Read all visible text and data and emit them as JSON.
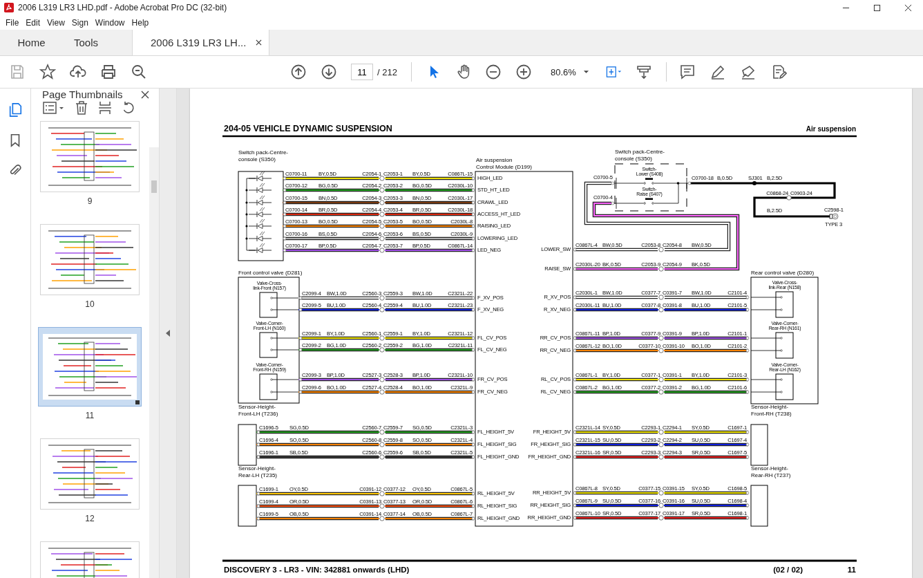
{
  "window": {
    "title": "2006 L319 LR3 LHD.pdf - Adobe Acrobat Pro DC (32-bit)"
  },
  "menu": [
    "File",
    "Edit",
    "View",
    "Sign",
    "Window",
    "Help"
  ],
  "tabs": [
    {
      "label": "Home",
      "selected": false,
      "closable": false
    },
    {
      "label": "Tools",
      "selected": false,
      "closable": false
    },
    {
      "label": "2006 L319 LR3 LH...",
      "selected": true,
      "closable": true
    }
  ],
  "toolbar": {
    "page": "11",
    "page_count": "/ 212",
    "zoom": "80.6%",
    "tools": [
      {
        "kind": "select",
        "selected": true
      },
      {
        "kind": "hand",
        "selected": false
      }
    ]
  },
  "rail": [
    {
      "kind": "pages",
      "selected": true
    },
    {
      "kind": "bookmarks",
      "selected": false
    },
    {
      "kind": "attachments",
      "selected": false
    }
  ],
  "panel": {
    "title": "Page Thumbnails",
    "thumbnails": [
      {
        "label": "9",
        "selected": false
      },
      {
        "label": "10",
        "selected": false
      },
      {
        "label": "11",
        "selected": true
      },
      {
        "label": "12",
        "selected": false
      },
      {
        "selected": false
      }
    ]
  },
  "diagram": {
    "title": "204-05 VEHICLE DYNAMIC SUSPENSION",
    "section": "Air suspension",
    "footer": "DISCOVERY 3 - LR3 - VIN: 342881 onwards  (LHD)",
    "sheet": "(02 / 02)",
    "page": "11",
    "module": {
      "lines": [
        "Air suspension",
        "Control Module (D199)"
      ]
    },
    "left_groups": [
      {
        "kind": "switch_pack",
        "lines": [
          "Switch pack-Centre-",
          "console (S350)"
        ],
        "wires": [
          {
            "from": "C0700-11",
            "spec": "BY,0.5D",
            "mid_a": "C2054-1",
            "mid_b": "C2053-1",
            "spec2": "BY,0.5D",
            "to": "C0867L-15",
            "pin": "HIGH_LED",
            "color": "#f2e600"
          },
          {
            "from": "C0700-12",
            "spec": "BG,0.5D",
            "mid_a": "C2054-2",
            "mid_b": "C2053-2",
            "spec2": "BG,0.5D",
            "to": "C2030L-10",
            "pin": "STD_HT_LED",
            "color": "#22a020"
          },
          {
            "from": "C0700-15",
            "spec": "BN,0.5D",
            "mid_a": "C2054-3",
            "mid_b": "C2053-3",
            "spec2": "BN,0.5D",
            "to": "C2030L-17",
            "pin": "CRAWL_LED",
            "color": "#7a3a10"
          },
          {
            "from": "C0700-14",
            "spec": "BR,0.5D",
            "mid_a": "C2054-4",
            "mid_b": "C2053-4",
            "spec2": "BR,0.5D",
            "to": "C2030L-18",
            "pin": "ACCESS_HT_LED",
            "color": "#e02a10"
          },
          {
            "from": "C0700-13",
            "spec": "BO,0.5D",
            "mid_a": "C2054-5",
            "mid_b": "C2053-5",
            "spec2": "BO,0.5D",
            "to": "C2030L-8",
            "pin": "RAISING_LED",
            "color": "#ff8400"
          },
          {
            "from": "C0700-16",
            "spec": "BS,0.5D",
            "mid_a": "C2054-6",
            "mid_b": "C2053-6",
            "spec2": "BS,0.5D",
            "to": "C2030L-9",
            "pin": "LOWERING_LED",
            "color": "#b4b4b4"
          },
          {
            "from": "C0700-17",
            "spec": "BP,0.5D",
            "mid_a": "C2054-7",
            "mid_b": "C2053-7",
            "spec2": "BP,0.5D",
            "to": "C0867L-14",
            "pin": "LED_NEG",
            "color": "#a050e8"
          }
        ]
      },
      {
        "kind": "valve_block",
        "lines": [
          "Front control valve (D281)"
        ],
        "parts": [
          {
            "lines": [
              "Valve-Cross-",
              "link-Front (N157)"
            ]
          },
          {
            "lines": [
              "Valve-Corner-",
              "Front-LH (N160)"
            ]
          },
          {
            "lines": [
              "Valve-Corner-",
              "Front-RH (N159)"
            ]
          }
        ],
        "wires": [
          {
            "from": "C2099-4",
            "spec": "BW,1.0D",
            "mid_a": "C2560-3",
            "mid_b": "C2559-3",
            "spec2": "BW,1.0D",
            "to": "C2321L-22",
            "pin": "F_XV_POS",
            "color": "#ffffff"
          },
          {
            "from": "C2099-5",
            "spec": "BU,1.0D",
            "mid_a": "C2560-4",
            "mid_b": "C2559-4",
            "spec2": "BU,1.0D",
            "to": "C2321L-23",
            "pin": "F_XV_NEG",
            "color": "#1020e0"
          },
          {
            "from": "C2099-1",
            "spec": "BY,1.0D",
            "mid_a": "C2560-1",
            "mid_b": "C2559-1",
            "spec2": "BY,1.0D",
            "to": "C2321L-12",
            "pin": "FL_CV_POS",
            "color": "#f2e600"
          },
          {
            "from": "C2099-2",
            "spec": "BG,1.0D",
            "mid_a": "C2560-2",
            "mid_b": "C2559-2",
            "spec2": "BG,1.0D",
            "to": "C2321L-11",
            "pin": "FL_CV_NEG",
            "color": "#22a020"
          },
          {
            "from": "C2099-3",
            "spec": "BP,1.0D",
            "mid_a": "C2527-3",
            "mid_b": "C2528-3",
            "spec2": "BP,1.0D",
            "to": "C2321L-10",
            "pin": "FR_CV_POS",
            "color": "#a050e8"
          },
          {
            "from": "C2099-6",
            "spec": "BO,1.0D",
            "mid_a": "C2527-4",
            "mid_b": "C2528-4",
            "spec2": "BO,1.0D",
            "to": "C2321L-9",
            "pin": "FR_CV_NEG",
            "color": "#ff8400"
          }
        ]
      },
      {
        "kind": "sensor",
        "lines": [
          "Sensor-Height-",
          "Front-LH (T236)"
        ],
        "wires": [
          {
            "from": "C1696-5",
            "spec": "SG,0.5D",
            "mid_a": "C2560-7",
            "mid_b": "C2559-7",
            "spec2": "SG,0.5D",
            "to": "C2321L-3",
            "pin": "FL_HEIGHT_5V",
            "color": "#22a020"
          },
          {
            "from": "C1696-4",
            "spec": "SO,0.5D",
            "mid_a": "C2560-8",
            "mid_b": "C2559-8",
            "spec2": "SO,0.5D",
            "to": "C2321L-4",
            "pin": "FL_HEIGHT_SIG",
            "color": "#ff8400"
          },
          {
            "from": "C1696-1",
            "spec": "SB,0.5D",
            "mid_a": "C2560-6",
            "mid_b": "C2559-6",
            "spec2": "SB,0.5D",
            "to": "C2321L-5",
            "pin": "FL_HEIGHT_GND",
            "color": "#333333"
          }
        ]
      },
      {
        "kind": "sensor",
        "lines": [
          "Sensor-Height-",
          "Rear-LH (T235)"
        ],
        "wires": [
          {
            "from": "C1699-1",
            "spec": "OY,0.5D",
            "mid_a": "C0391-12",
            "mid_b": "C0377-12",
            "spec2": "OY,0.5D",
            "to": "C0867L-5",
            "pin": "RL_HEIGHT_5V",
            "color": "#ffc800"
          },
          {
            "from": "C1699-4",
            "spec": "OR,0.5D",
            "mid_a": "C0391-13",
            "mid_b": "C0377-13",
            "spec2": "OR,0.5D",
            "to": "C0867L-6",
            "pin": "RL_HEIGHT_SIG",
            "color": "#ff5010"
          },
          {
            "from": "C1699-5",
            "spec": "OB,0.5D",
            "mid_a": "C0391-14",
            "mid_b": "C0377-14",
            "spec2": "OB,0.5D",
            "to": "C0867L-7",
            "pin": "RL_HEIGHT_GND",
            "color": "#ff8400"
          }
        ]
      }
    ],
    "right_groups": [
      {
        "kind": "switch_feed",
        "wires": [
          {
            "pin": "LOWER_SW",
            "from": "C0867L-4",
            "spec": "BW,0.5D",
            "mid_a": "C2053-8",
            "mid_b": "C2054-8",
            "spec2": "BW,0.5D",
            "color": "#ffffff"
          },
          {
            "pin": "RAISE_SW",
            "from": "C2030L-20",
            "spec": "BK,0.5D",
            "mid_a": "C2053-9",
            "mid_b": "C2054-9",
            "spec2": "BK,0.5D",
            "color": "#ff66ff"
          }
        ]
      },
      {
        "kind": "valve_block",
        "lines": [
          "Rear control valve (D280)"
        ],
        "parts": [
          {
            "lines": [
              "Valve-Cross-",
              "link-Rear (N158)"
            ]
          },
          {
            "lines": [
              "Valve-Corner-",
              "Rear-RH (N161)"
            ]
          },
          {
            "lines": [
              "Valve-Corner-",
              "Rear-LH (N162)"
            ]
          }
        ],
        "wires": [
          {
            "pin": "R_XV_POS",
            "from": "C2030L-1",
            "spec": "BW,1.0D",
            "mid_a": "C0377-7",
            "mid_b": "C0391-7",
            "spec2": "BW,1.0D",
            "to": "C2101-4",
            "color": "#ffffff"
          },
          {
            "pin": "R_XV_NEG",
            "from": "C2030L-11",
            "spec": "BU,1.0D",
            "mid_a": "C0377-8",
            "mid_b": "C0391-8",
            "spec2": "BU,1.0D",
            "to": "C2101-5",
            "color": "#1020e0"
          },
          {
            "pin": "RR_CV_POS",
            "from": "C0867L-11",
            "spec": "BP,1.0D",
            "mid_a": "C0377-9",
            "mid_b": "C0391-9",
            "spec2": "BP,1.0D",
            "to": "C2101-1",
            "color": "#a050e8"
          },
          {
            "pin": "RR_CV_NEG",
            "from": "C0867L-12",
            "spec": "BO,1.0D",
            "mid_a": "C0377-10",
            "mid_b": "C0391-10",
            "spec2": "BO,1.0D",
            "to": "C2101-2",
            "color": "#ff8400"
          },
          {
            "pin": "RL_CV_POS",
            "from": "C0867L-1",
            "spec": "BY,1.0D",
            "mid_a": "C0377-1",
            "mid_b": "C0391-1",
            "spec2": "BY,1.0D",
            "to": "C2101-3",
            "color": "#f2e600"
          },
          {
            "pin": "RL_CV_NEG",
            "from": "C0867L-2",
            "spec": "BG,1.0D",
            "mid_a": "C0377-2",
            "mid_b": "C0391-2",
            "spec2": "BG,1.0D",
            "to": "C2101-6",
            "color": "#22a020"
          }
        ]
      },
      {
        "kind": "sensor",
        "lines": [
          "Sensor-Height-",
          "Front-RH (T238)"
        ],
        "wires": [
          {
            "pin": "FR_HEIGHT_5V",
            "from": "C2321L-14",
            "spec": "SY,0.5D",
            "mid_a": "C2293-1",
            "mid_b": "C2294-1",
            "spec2": "SY,0.5D",
            "to": "C1697-1",
            "color": "#f2e600"
          },
          {
            "pin": "FR_HEIGHT_SIG",
            "from": "C2321L-15",
            "spec": "SU,0.5D",
            "mid_a": "C2293-2",
            "mid_b": "C2294-2",
            "spec2": "SU,0.5D",
            "to": "C1697-4",
            "color": "#1020e0"
          },
          {
            "pin": "FR_HEIGHT_GND",
            "from": "C2321L-16",
            "spec": "SR,0.5D",
            "mid_a": "C2293-3",
            "mid_b": "C2294-3",
            "spec2": "SR,0.5D",
            "to": "C1697-5",
            "color": "#f02020"
          }
        ]
      },
      {
        "kind": "sensor",
        "lines": [
          "Sensor-Height-",
          "Rear-RH (T237)"
        ],
        "wires": [
          {
            "pin": "RR_HEIGHT_5V",
            "from": "C0867L-8",
            "spec": "SY,0.5D",
            "mid_a": "C0377-15",
            "mid_b": "C0391-15",
            "spec2": "SY,0.5D",
            "to": "C1698-5",
            "color": "#f2e600"
          },
          {
            "pin": "RR_HEIGHT_SIG",
            "from": "C0867L-9",
            "spec": "SU,0.5D",
            "mid_a": "C0377-16",
            "mid_b": "C0391-16",
            "spec2": "SU,0.5D",
            "to": "C1698-4",
            "color": "#1020e0"
          },
          {
            "pin": "RR_HEIGHT_GND",
            "from": "C0867L-10",
            "spec": "SR,0.5D",
            "mid_a": "C0377-17",
            "mid_b": "C0391-17",
            "spec2": "SR,0.5D",
            "to": "C1698-1",
            "color": "#f02020"
          }
        ]
      }
    ],
    "switch_pack": {
      "lines": [
        "Switch pack-Centre-",
        "console (S350)"
      ],
      "switches": [
        {
          "lines": [
            "Switch-",
            "Lower (S408)"
          ]
        },
        {
          "lines": [
            "Switch-",
            "Raise (S407)"
          ]
        }
      ],
      "pins": [
        "C0700-5",
        "C0700-4"
      ],
      "out_pin": "C0700-18",
      "out_spec": "B,0.5D",
      "splice": "SJ301",
      "splice_spec": "B,2.5D",
      "inline": [
        "C0868-24",
        "C0903-24"
      ],
      "ground_spec": "B,2.5D",
      "ground": "C2598-1",
      "ground_type": "TYPE 3"
    }
  }
}
